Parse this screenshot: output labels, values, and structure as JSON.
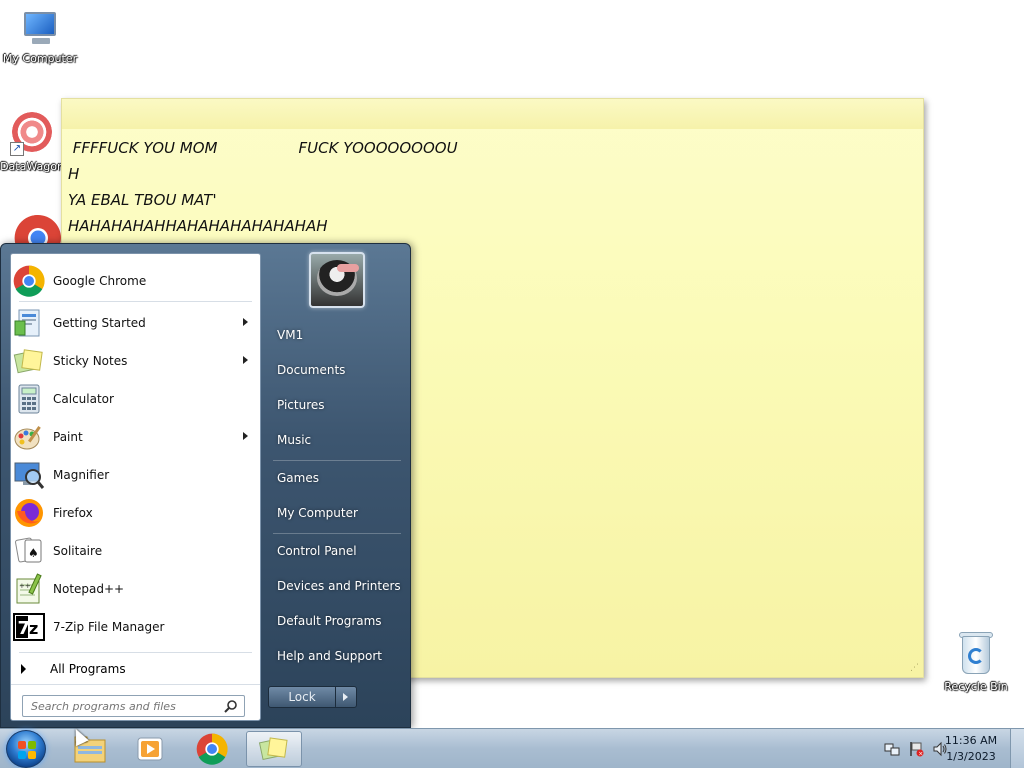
{
  "desktop": {
    "icons": [
      {
        "label": "My Computer"
      },
      {
        "label": "DataWagon"
      },
      {
        "label": "Recycle Bin"
      }
    ]
  },
  "sticky_note": {
    "text": " FFFFUCK YOU MOM                 FUCK YOOOOOOOOU\nH\nYA EBAL TBOU MAT'\nHAHAHAHAHHAHAHAHAHAHAHAH"
  },
  "start_menu": {
    "programs": [
      {
        "label": "Google Chrome",
        "icon": "chrome-icon"
      },
      {
        "label": "Getting Started",
        "icon": "getting-started-icon",
        "submenu": true
      },
      {
        "label": "Sticky Notes",
        "icon": "sticky-notes-icon",
        "submenu": true
      },
      {
        "label": "Calculator",
        "icon": "calculator-icon"
      },
      {
        "label": "Paint",
        "icon": "paint-icon",
        "submenu": true
      },
      {
        "label": "Magnifier",
        "icon": "magnifier-icon"
      },
      {
        "label": "Firefox",
        "icon": "firefox-icon"
      },
      {
        "label": "Solitaire",
        "icon": "solitaire-icon"
      },
      {
        "label": "Notepad++",
        "icon": "notepadpp-icon"
      },
      {
        "label": "7-Zip File Manager",
        "icon": "7zip-icon"
      }
    ],
    "all_programs": "All Programs",
    "search_placeholder": "Search programs and files",
    "right_items": {
      "user": "VM1",
      "documents": "Documents",
      "pictures": "Pictures",
      "music": "Music",
      "games": "Games",
      "my_computer": "My Computer",
      "control_panel": "Control Panel",
      "devices_printers": "Devices and Printers",
      "default_programs": "Default Programs",
      "help_support": "Help and Support"
    },
    "lock_label": "Lock"
  },
  "taskbar": {
    "pinned": [
      "explorer-icon",
      "media-player-icon",
      "chrome-icon",
      "sticky-notes-icon"
    ],
    "clock_time": "11:36 AM",
    "clock_date": "1/3/2023"
  },
  "colors": {
    "sticky_yellow": "#fbfbb8",
    "taskbar": "#a9bdd1",
    "start_menu_dark": "#3d5670"
  }
}
